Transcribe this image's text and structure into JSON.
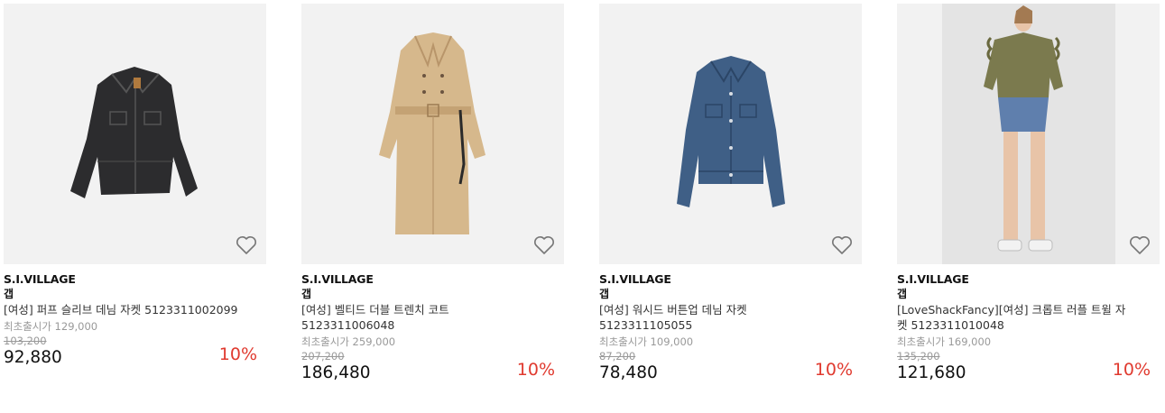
{
  "colors": {
    "discount": "#e03a2f",
    "thumb_bg": "#f2f2f2"
  },
  "products": [
    {
      "brand": "S.I.VILLAGE",
      "sub_brand": "갭",
      "name": "[여성] 퍼프 슬리브 데님 자켓 5123311002099",
      "original_label": "최초출시가 129,000",
      "list_price": "103,200",
      "price": "92,880",
      "discount": "10%",
      "image_icon": "black-denim-jacket",
      "wish_icon": "heart-outline-icon"
    },
    {
      "brand": "S.I.VILLAGE",
      "sub_brand": "갭",
      "name": "[여성] 벨티드 더블 트렌치 코트 5123311006048",
      "original_label": "최초출시가 259,000",
      "list_price": "207,200",
      "price": "186,480",
      "discount": "10%",
      "image_icon": "beige-trench-coat",
      "wish_icon": "heart-outline-icon"
    },
    {
      "brand": "S.I.VILLAGE",
      "sub_brand": "갭",
      "name": "[여성] 워시드 버튼업 데님 자켓 5123311105055",
      "original_label": "최초출시가 109,000",
      "list_price": "87,200",
      "price": "78,480",
      "discount": "10%",
      "image_icon": "blue-denim-jacket",
      "wish_icon": "heart-outline-icon"
    },
    {
      "brand": "S.I.VILLAGE",
      "sub_brand": "갭",
      "name": "[LoveShackFancy][여성] 크롭트 러플 트윌 자켓 5123311010048",
      "original_label": "최초출시가 169,000",
      "list_price": "135,200",
      "price": "121,680",
      "discount": "10%",
      "image_icon": "model-olive-ruffle-jacket",
      "wish_icon": "heart-outline-icon"
    }
  ]
}
